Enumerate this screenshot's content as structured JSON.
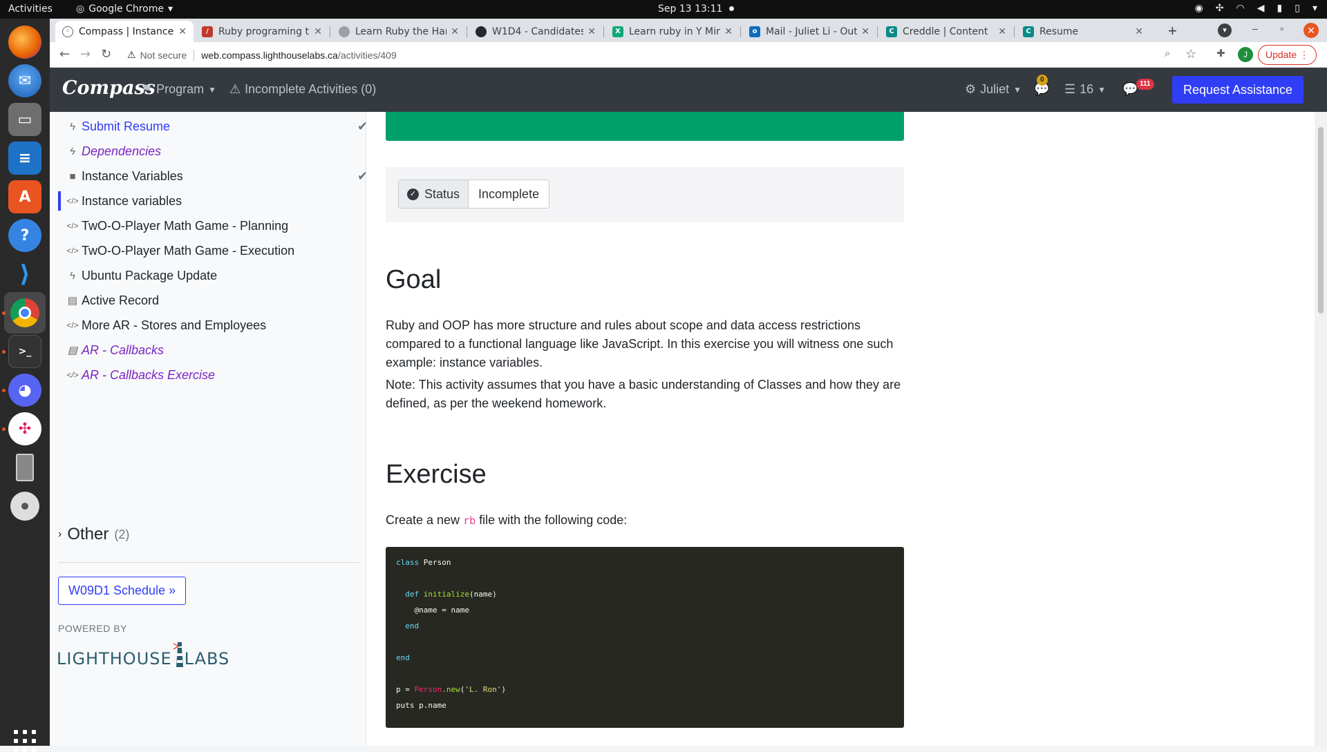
{
  "os": {
    "activities": "Activities",
    "app_name": "Google Chrome",
    "clock": "Sep 13  13:11"
  },
  "dock": {
    "items": [
      "firefox",
      "thunderbird",
      "files",
      "libreoffice-writer",
      "ubuntu-software",
      "help",
      "vscode",
      "chrome",
      "terminal",
      "discord",
      "slack",
      "tablet-device",
      "optical-disc"
    ]
  },
  "browser": {
    "tabs": [
      {
        "title": "Compass | Instance Variables",
        "favicon_color": "#5f6368"
      },
      {
        "title": "Ruby programing tutorial",
        "favicon_color": "#c0392b"
      },
      {
        "title": "Learn Ruby the Hard Way",
        "favicon_color": "#5f6368"
      },
      {
        "title": "W1D4 - Candidates",
        "favicon_color": "#24292e"
      },
      {
        "title": "Learn ruby in Y Minutes",
        "favicon_color": "#12a876"
      },
      {
        "title": "Mail - Juliet Li - Outlook",
        "favicon_color": "#0f6cbd"
      },
      {
        "title": "Creddle | Content",
        "favicon_color": "#0d8a8a"
      },
      {
        "title": "Resume",
        "favicon_color": "#0d8a8a"
      }
    ],
    "url_security": "Not secure",
    "url_host": "web.compass.lighthouselabs.ca",
    "url_path": "/activities/409",
    "update_label": "Update",
    "profile_initial": "J"
  },
  "navbar": {
    "brand": "Compass",
    "program": "Program",
    "incomplete": "Incomplete Activities (0)",
    "user": "Juliet",
    "notif_count": "0",
    "list_count": "16",
    "messages_count": "111",
    "request_assistance": "Request Assistance"
  },
  "sidebar": {
    "items": [
      {
        "label": "Submit Resume",
        "icon": "bolt-icon",
        "style": "link",
        "checked": true
      },
      {
        "label": "Dependencies",
        "icon": "bolt-icon",
        "style": "optional",
        "checked": false
      },
      {
        "label": "Instance Variables",
        "icon": "video-icon",
        "style": "normal",
        "checked": true
      },
      {
        "label": "Instance variables",
        "icon": "code-icon",
        "style": "current",
        "checked": false
      },
      {
        "label": "TwO-O-Player Math Game - Planning",
        "icon": "code-icon",
        "style": "normal",
        "checked": false
      },
      {
        "label": "TwO-O-Player Math Game - Execution",
        "icon": "code-icon",
        "style": "normal",
        "checked": false
      },
      {
        "label": "Ubuntu Package Update",
        "icon": "bolt-icon",
        "style": "normal",
        "checked": false
      },
      {
        "label": "Active Record",
        "icon": "book-icon",
        "style": "normal",
        "checked": false
      },
      {
        "label": "More AR - Stores and Employees",
        "icon": "code-icon",
        "style": "normal",
        "checked": false
      },
      {
        "label": "AR - Callbacks",
        "icon": "book-icon",
        "style": "optional",
        "checked": false
      },
      {
        "label": "AR - Callbacks Exercise",
        "icon": "code-icon",
        "style": "optional",
        "checked": false
      }
    ],
    "other_label": "Other",
    "other_count": "(2)",
    "schedule_button": "W09D1 Schedule »",
    "powered_by": "POWERED BY",
    "logo_text_1": "LIGHTHOUSE",
    "logo_text_2": "LABS"
  },
  "main": {
    "status_label": "Status",
    "status_value": "Incomplete",
    "goal_heading": "Goal",
    "goal_p1": "Ruby and OOP has more structure and rules about scope and data access restrictions compared to a functional language like JavaScript. In this exercise you will witness one such example: instance variables.",
    "goal_p2": "Note: This activity assumes that you have a basic understanding of Classes and how they are defined, as per the weekend homework.",
    "exercise_heading": "Exercise",
    "exercise_intro_before": "Create a new ",
    "exercise_intro_code": "rb",
    "exercise_intro_after": " file with the following code:",
    "code": {
      "l1_kw": "class",
      "l1_rest": " Person",
      "l3_kw": "  def",
      "l3_fn": " initialize",
      "l3_rest": "(name)",
      "l4": "    @name = name",
      "l5_kw": "  end",
      "l7_kw": "end",
      "l9_pre": "p = ",
      "l9_cls": "Person",
      "l9_fn": ".new",
      "l9_open": "(",
      "l9_str": "'L. Ron'",
      "l9_close": ")",
      "l10": "puts p.name"
    }
  }
}
